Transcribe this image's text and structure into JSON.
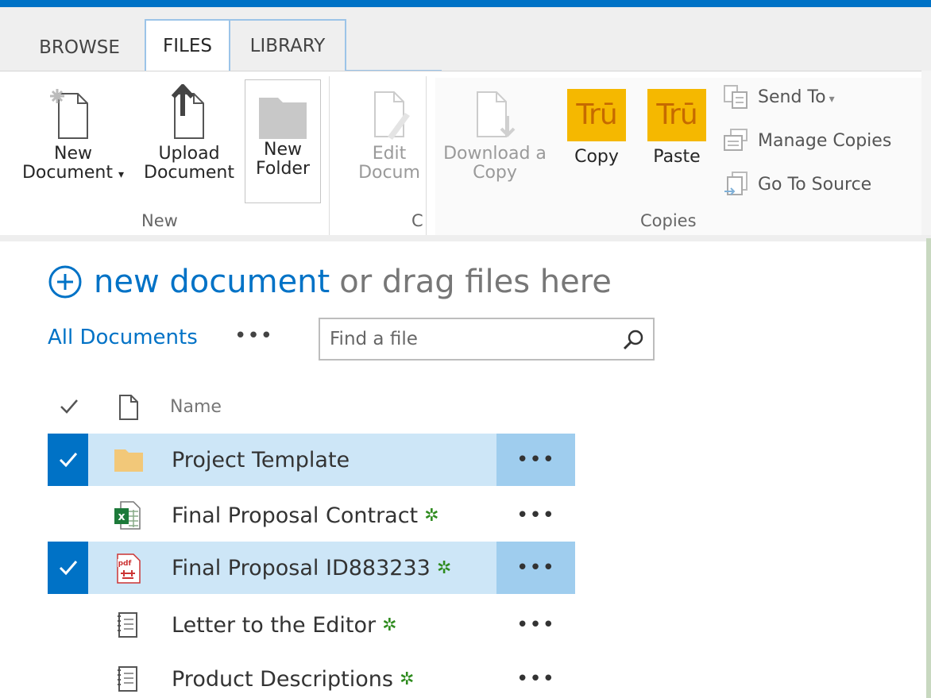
{
  "tabs": {
    "browse": "BROWSE",
    "files": "FILES",
    "library": "LIBRARY"
  },
  "ribbon": {
    "new_document": [
      "New",
      "Document"
    ],
    "upload_document": [
      "Upload",
      "Document"
    ],
    "new_folder": [
      "New",
      "Folder"
    ],
    "edit_document": [
      "Edit",
      "Docum"
    ],
    "download_copy": [
      "Download a",
      "Copy"
    ],
    "tru_logo": "Trū",
    "copy": "Copy",
    "paste": "Paste",
    "send_to": "Send To",
    "manage_copies": "Manage Copies",
    "go_to_source": "Go To Source",
    "group_new": "New",
    "group_c": "C",
    "group_copies": "Copies"
  },
  "main": {
    "new_document_link": "new document",
    "drag_text": "or drag files here",
    "view_name": "All Documents",
    "more": "•••",
    "search_placeholder": "Find a file",
    "column_name": "Name"
  },
  "files": [
    {
      "name": "Project Template",
      "type": "folder",
      "selected": true,
      "new": false
    },
    {
      "name": "Final Proposal Contract",
      "type": "excel",
      "selected": false,
      "new": true
    },
    {
      "name": "Final Proposal ID883233",
      "type": "pdf",
      "selected": true,
      "new": true
    },
    {
      "name": "Letter to the Editor",
      "type": "text",
      "selected": false,
      "new": true
    },
    {
      "name": "Product Descriptions",
      "type": "text",
      "selected": false,
      "new": true
    }
  ],
  "new_marker": "✲",
  "colors": {
    "accent": "#0072c6",
    "tru_yellow": "#f5b800",
    "selection": "#cde6f7",
    "new_green": "#2e8b1e"
  }
}
